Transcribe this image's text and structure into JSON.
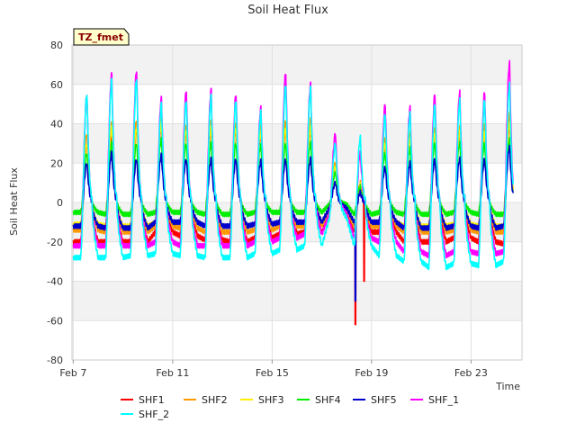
{
  "chart_data": {
    "type": "line",
    "title": "Soil Heat Flux",
    "xlabel": "Time",
    "ylabel": "Soil Heat Flux",
    "badge": "TZ_fmet",
    "x_start": "Feb 7",
    "x_end": "Feb 25",
    "xlim": [
      6.95,
      25.05
    ],
    "ylim": [
      -80,
      80
    ],
    "y_ticks": [
      -80,
      -60,
      -40,
      -20,
      0,
      20,
      40,
      60,
      80
    ],
    "x_ticks": [
      {
        "value": 7,
        "label": "Feb 7"
      },
      {
        "value": 11,
        "label": "Feb 11"
      },
      {
        "value": 15,
        "label": "Feb 15"
      },
      {
        "value": 19,
        "label": "Feb 19"
      },
      {
        "value": 23,
        "label": "Feb 23"
      }
    ],
    "grid": true,
    "band_fill": "#f2f2f2",
    "legend_position": "bottom",
    "days": [
      7.5,
      8.5,
      9.5,
      10.5,
      11.5,
      12.5,
      13.5,
      14.5,
      15.5,
      16.5,
      17.5,
      18.5,
      19.5,
      20.5,
      21.5,
      22.5,
      23.5,
      24.5
    ],
    "series": [
      {
        "name": "SHF1",
        "color": "#ff0000",
        "width": 1.6,
        "peak": [
          30,
          35,
          38,
          40,
          37,
          38,
          38,
          36,
          38,
          38,
          18,
          8,
          30,
          32,
          36,
          36,
          36,
          40
        ],
        "trough": [
          -20,
          -20,
          -20,
          -15,
          -17,
          -19,
          -20,
          -18,
          -16,
          -15,
          -5,
          -15,
          -15,
          -20,
          -20,
          -18,
          -20,
          -21
        ]
      },
      {
        "name": "SHF2",
        "color": "#ff9900",
        "width": 1.4,
        "peak": [
          35,
          40,
          42,
          43,
          40,
          41,
          41,
          40,
          42,
          42,
          20,
          10,
          33,
          35,
          38,
          38,
          40,
          45
        ],
        "trough": [
          -14,
          -15,
          -15,
          -12,
          -13,
          -15,
          -15,
          -14,
          -12,
          -12,
          -4,
          -12,
          -12,
          -15,
          -15,
          -14,
          -15,
          -15
        ]
      },
      {
        "name": "SHF3",
        "color": "#ffee00",
        "width": 1.4,
        "peak": [
          30,
          38,
          38,
          40,
          37,
          38,
          38,
          36,
          38,
          38,
          18,
          9,
          30,
          32,
          35,
          36,
          36,
          40
        ],
        "trough": [
          -11,
          -12,
          -12,
          -10,
          -10,
          -12,
          -12,
          -11,
          -10,
          -10,
          -3,
          -10,
          -10,
          -12,
          -12,
          -11,
          -12,
          -12
        ]
      },
      {
        "name": "SHF4",
        "color": "#00ee00",
        "width": 1.4,
        "peak": [
          25,
          30,
          30,
          32,
          30,
          30,
          30,
          29,
          30,
          30,
          15,
          8,
          25,
          27,
          30,
          30,
          30,
          32
        ],
        "trough": [
          -5,
          -6,
          -6,
          -5,
          -5,
          -6,
          -6,
          -5,
          -5,
          -5,
          -1,
          -6,
          -5,
          -6,
          -6,
          -5,
          -6,
          -6
        ]
      },
      {
        "name": "SHF5",
        "color": "#0000cc",
        "width": 1.6,
        "peak": [
          20,
          25,
          22,
          24,
          22,
          22,
          22,
          21,
          22,
          22,
          10,
          5,
          18,
          20,
          22,
          22,
          22,
          28
        ],
        "trough": [
          -12,
          -13,
          -13,
          -10,
          -10,
          -12,
          -12,
          -11,
          -10,
          -10,
          -3,
          -10,
          -10,
          -13,
          -13,
          -12,
          -13,
          -12
        ]
      },
      {
        "name": "SHF_1",
        "color": "#ff00ff",
        "width": 1.6,
        "peak": [
          55,
          65,
          67,
          53,
          57,
          57,
          55,
          48,
          66,
          60,
          35,
          25,
          50,
          48,
          55,
          56,
          56,
          71
        ],
        "trough": [
          -22,
          -22,
          -22,
          -20,
          -22,
          -22,
          -22,
          -20,
          -18,
          -16,
          -6,
          -18,
          -20,
          -25,
          -27,
          -25,
          -26,
          -25
        ]
      },
      {
        "name": "SHF_2",
        "color": "#00ffff",
        "width": 1.6,
        "peak": [
          55,
          62,
          63,
          50,
          52,
          54,
          52,
          46,
          60,
          58,
          30,
          33,
          45,
          45,
          50,
          52,
          52,
          60
        ],
        "trough": [
          -28,
          -28,
          -27,
          -26,
          -27,
          -28,
          -28,
          -26,
          -24,
          -22,
          -8,
          -22,
          -27,
          -30,
          -33,
          -31,
          -32,
          -30
        ]
      }
    ],
    "annotations": [
      {
        "series": "SHF1",
        "x": 18.35,
        "y": -62
      },
      {
        "series": "SHF1",
        "x": 18.7,
        "y": -40
      },
      {
        "series": "SHF5",
        "x": 18.35,
        "y": -50
      }
    ]
  }
}
